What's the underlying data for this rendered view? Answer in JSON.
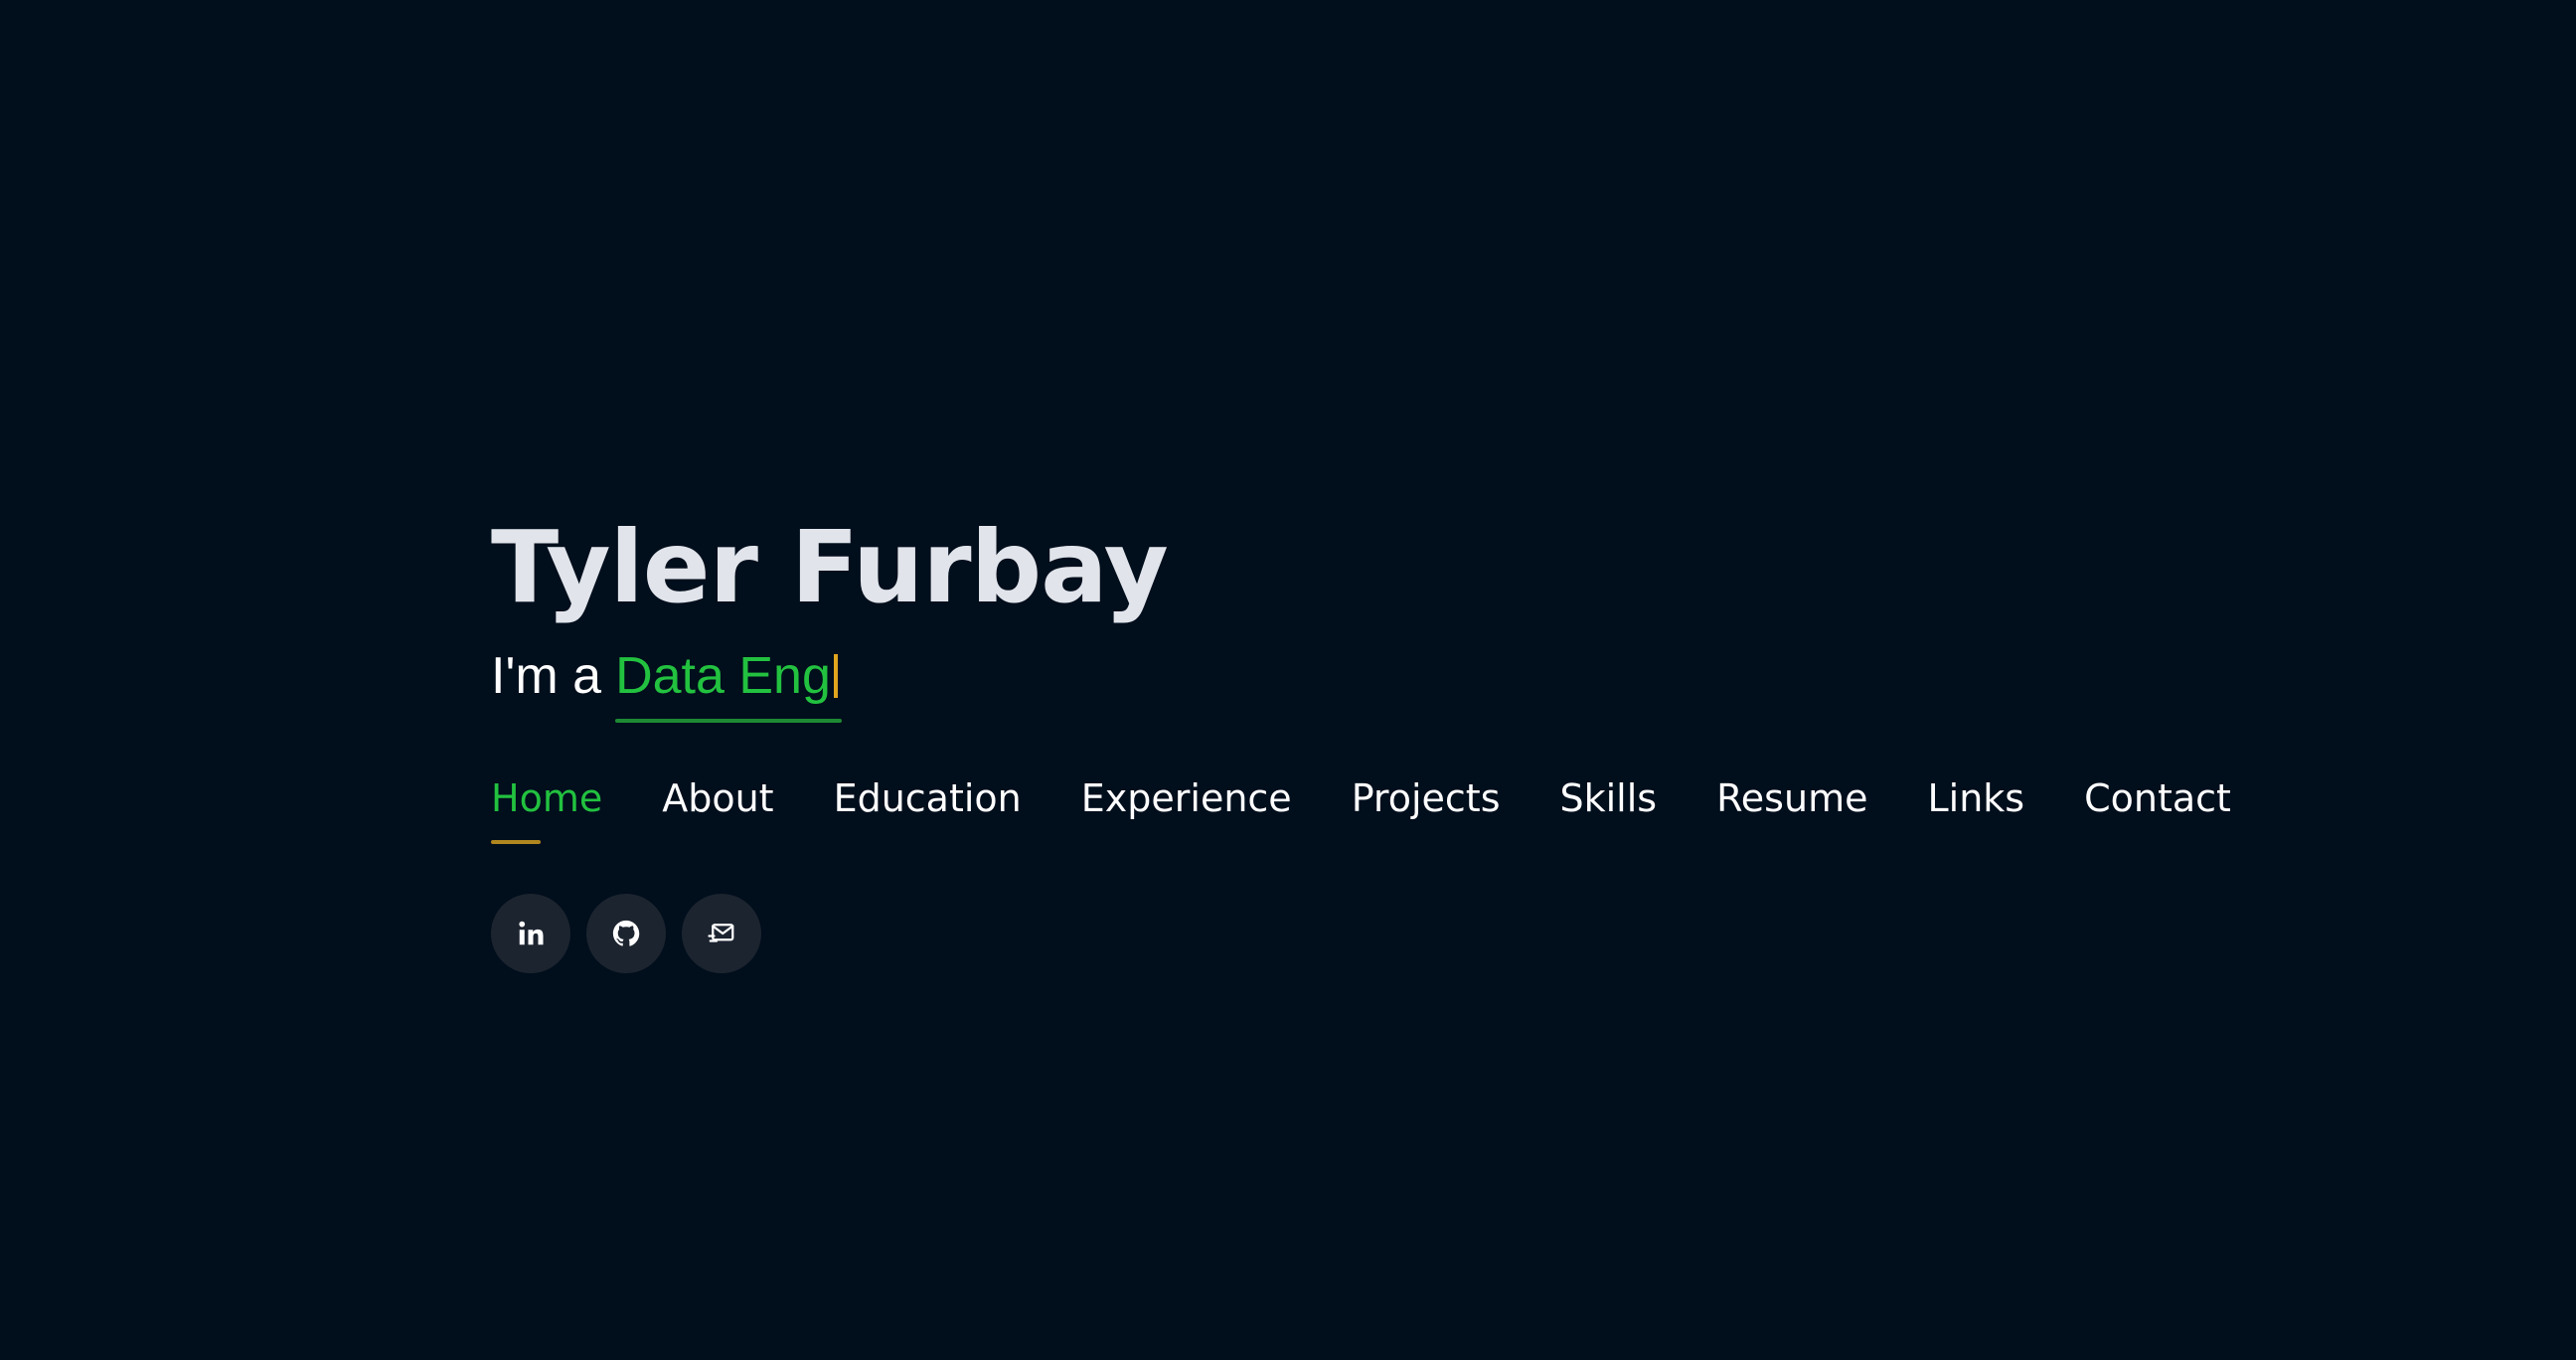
{
  "hero": {
    "name": "Tyler Furbay",
    "tagline_prefix": "I'm a",
    "tagline_typed": "Data Eng"
  },
  "nav": {
    "items": [
      {
        "label": "Home",
        "active": true
      },
      {
        "label": "About",
        "active": false
      },
      {
        "label": "Education",
        "active": false
      },
      {
        "label": "Experience",
        "active": false
      },
      {
        "label": "Projects",
        "active": false
      },
      {
        "label": "Skills",
        "active": false
      },
      {
        "label": "Resume",
        "active": false
      },
      {
        "label": "Links",
        "active": false
      },
      {
        "label": "Contact",
        "active": false
      }
    ]
  },
  "socials": [
    {
      "icon": "linkedin-icon"
    },
    {
      "icon": "github-icon"
    },
    {
      "icon": "mail-icon"
    }
  ],
  "colors": {
    "background": "#010e1c",
    "accent_green": "#22c13f",
    "accent_gold": "#e0a51e",
    "name_text": "#e1e4ea",
    "social_bg": "#1c2430"
  }
}
